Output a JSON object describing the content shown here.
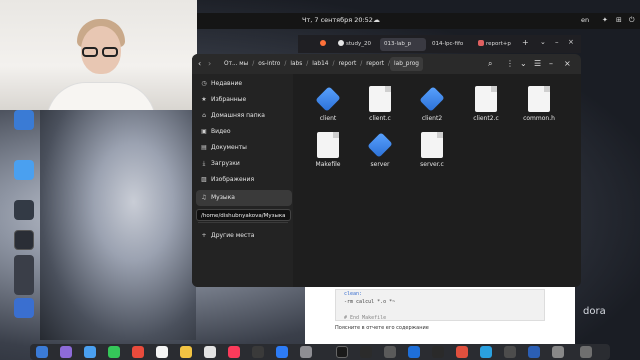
{
  "topbar": {
    "clock": "Чт, 7 сентября 20:52",
    "lang": "en"
  },
  "browser": {
    "tabs": [
      {
        "label": "",
        "icon": "firefox-icon",
        "color": "#ff7139"
      },
      {
        "label": "study_20",
        "icon": "github-icon",
        "color": "#e6e6e6"
      },
      {
        "label": "013-lab_p",
        "icon": "",
        "color": ""
      },
      {
        "label": "014-lpc-fifo",
        "icon": "",
        "color": ""
      },
      {
        "label": "report+p",
        "icon": "page-icon",
        "color": "#e06060"
      }
    ],
    "new_tab": "+"
  },
  "filemanager": {
    "breadcrumb": [
      "От... мы",
      "os-intro",
      "labs",
      "lab14",
      "report",
      "report",
      "lab_prog"
    ],
    "sidebar": [
      {
        "label": "Недавние",
        "icon": "clock-icon"
      },
      {
        "label": "Избранные",
        "icon": "star-icon"
      },
      {
        "label": "Домашняя папка",
        "icon": "home-icon"
      },
      {
        "label": "Видео",
        "icon": "video-icon"
      },
      {
        "label": "Документы",
        "icon": "document-icon"
      },
      {
        "label": "Загрузки",
        "icon": "download-icon"
      },
      {
        "label": "Изображения",
        "icon": "image-icon"
      },
      {
        "label": "Музыка",
        "icon": "music-icon"
      },
      {
        "label": "Другие места",
        "icon": "plus-icon"
      }
    ],
    "tooltip": "/home/dishubnyakova/Музыка",
    "files": [
      {
        "name": "client",
        "type": "executable"
      },
      {
        "name": "client.c",
        "type": "text"
      },
      {
        "name": "client2",
        "type": "executable"
      },
      {
        "name": "client2.c",
        "type": "text"
      },
      {
        "name": "common.h",
        "type": "text"
      },
      {
        "name": "Makefile",
        "type": "text"
      },
      {
        "name": "server",
        "type": "executable"
      },
      {
        "name": "server.c",
        "type": "text"
      }
    ]
  },
  "document": {
    "code_lines": [
      "clean:",
      "        -rm calcul *.o *~",
      "",
      "# End Makefile"
    ],
    "text": "Поясните в отчете его содержание"
  },
  "desktop": {
    "brand": "dora"
  }
}
